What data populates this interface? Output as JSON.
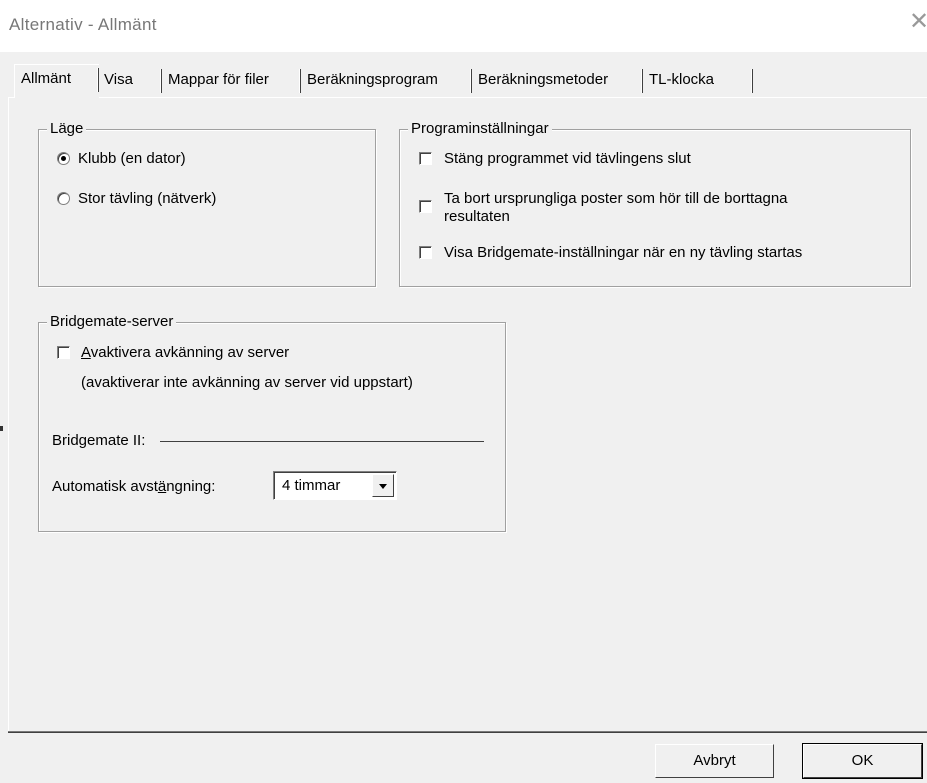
{
  "window": {
    "title": "Alternativ - Allmänt",
    "close_glyph": "✕"
  },
  "tabs": [
    {
      "label": "Allmänt"
    },
    {
      "label": "Visa"
    },
    {
      "label": "Mappar för filer"
    },
    {
      "label": "Beräkningsprogram"
    },
    {
      "label": "Beräkningsmetoder"
    },
    {
      "label": "TL-klocka"
    }
  ],
  "mode_group": {
    "legend": "Läge",
    "options": [
      {
        "label": "Klubb (en dator)",
        "selected": true
      },
      {
        "label": "Stor tävling (nätverk)",
        "selected": false
      }
    ]
  },
  "program_group": {
    "legend": "Programinställningar",
    "options": [
      {
        "label": "Stäng programmet vid tävlingens slut",
        "checked": false
      },
      {
        "label_line1": "Ta bort ursprungliga poster som hör till de borttagna",
        "label_line2": "resultaten",
        "checked": false
      },
      {
        "label": "Visa Bridgemate-inställningar när en ny tävling startas",
        "checked": false
      }
    ]
  },
  "server_group": {
    "legend": "Bridgemate-server",
    "disable_detection": {
      "accel": "A",
      "rest": "vaktivera avkänning av server",
      "checked": false
    },
    "note": "(avaktiverar inte avkänning av server vid uppstart)",
    "bm2_label": "Bridgemate II:",
    "auto_off": {
      "label_pre": "Automatisk avst",
      "label_accel": "ä",
      "label_post": "ngning:",
      "value": "4 timmar"
    }
  },
  "buttons": {
    "cancel": "Avbryt",
    "ok": "OK"
  }
}
